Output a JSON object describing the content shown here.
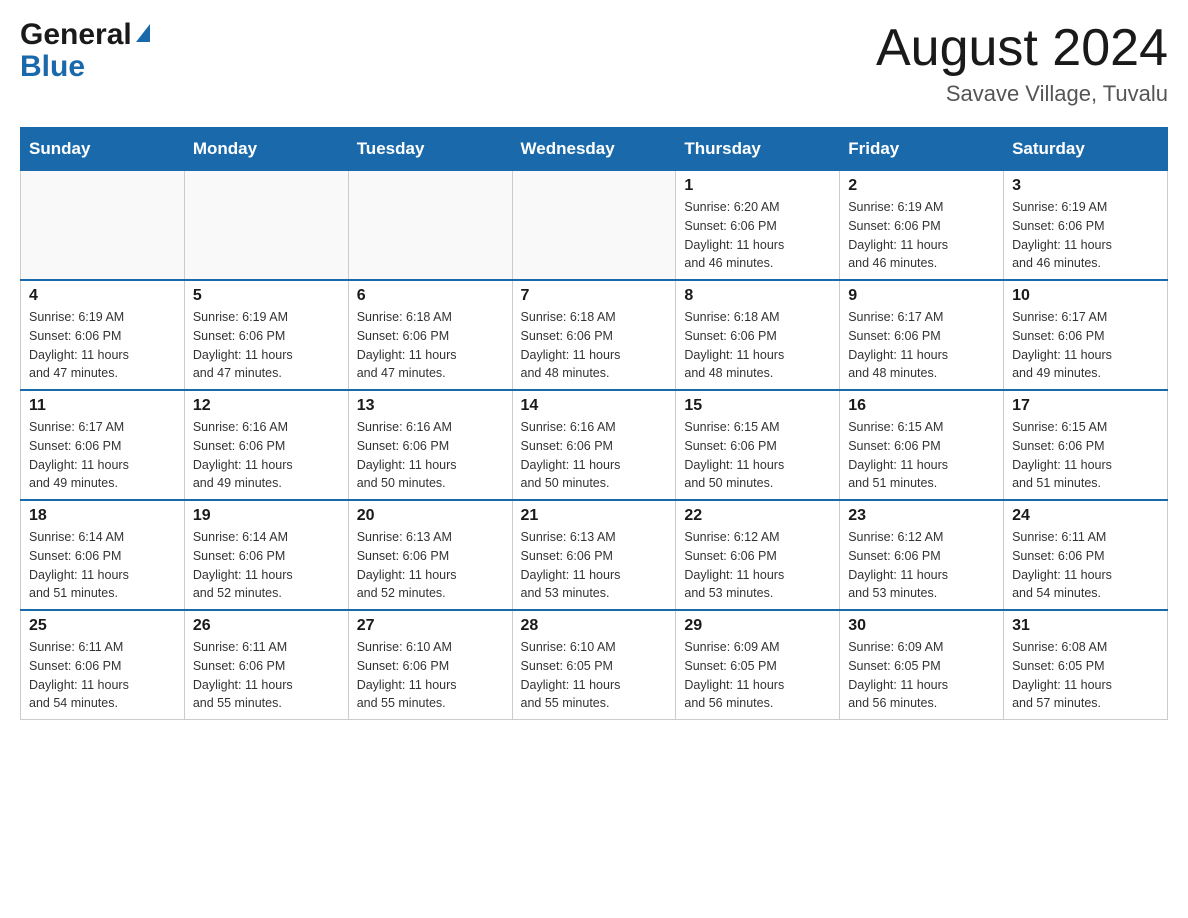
{
  "header": {
    "logo_general": "General",
    "logo_blue": "Blue",
    "month_title": "August 2024",
    "location": "Savave Village, Tuvalu"
  },
  "weekdays": [
    "Sunday",
    "Monday",
    "Tuesday",
    "Wednesday",
    "Thursday",
    "Friday",
    "Saturday"
  ],
  "weeks": [
    [
      {
        "day": "",
        "info": ""
      },
      {
        "day": "",
        "info": ""
      },
      {
        "day": "",
        "info": ""
      },
      {
        "day": "",
        "info": ""
      },
      {
        "day": "1",
        "info": "Sunrise: 6:20 AM\nSunset: 6:06 PM\nDaylight: 11 hours\nand 46 minutes."
      },
      {
        "day": "2",
        "info": "Sunrise: 6:19 AM\nSunset: 6:06 PM\nDaylight: 11 hours\nand 46 minutes."
      },
      {
        "day": "3",
        "info": "Sunrise: 6:19 AM\nSunset: 6:06 PM\nDaylight: 11 hours\nand 46 minutes."
      }
    ],
    [
      {
        "day": "4",
        "info": "Sunrise: 6:19 AM\nSunset: 6:06 PM\nDaylight: 11 hours\nand 47 minutes."
      },
      {
        "day": "5",
        "info": "Sunrise: 6:19 AM\nSunset: 6:06 PM\nDaylight: 11 hours\nand 47 minutes."
      },
      {
        "day": "6",
        "info": "Sunrise: 6:18 AM\nSunset: 6:06 PM\nDaylight: 11 hours\nand 47 minutes."
      },
      {
        "day": "7",
        "info": "Sunrise: 6:18 AM\nSunset: 6:06 PM\nDaylight: 11 hours\nand 48 minutes."
      },
      {
        "day": "8",
        "info": "Sunrise: 6:18 AM\nSunset: 6:06 PM\nDaylight: 11 hours\nand 48 minutes."
      },
      {
        "day": "9",
        "info": "Sunrise: 6:17 AM\nSunset: 6:06 PM\nDaylight: 11 hours\nand 48 minutes."
      },
      {
        "day": "10",
        "info": "Sunrise: 6:17 AM\nSunset: 6:06 PM\nDaylight: 11 hours\nand 49 minutes."
      }
    ],
    [
      {
        "day": "11",
        "info": "Sunrise: 6:17 AM\nSunset: 6:06 PM\nDaylight: 11 hours\nand 49 minutes."
      },
      {
        "day": "12",
        "info": "Sunrise: 6:16 AM\nSunset: 6:06 PM\nDaylight: 11 hours\nand 49 minutes."
      },
      {
        "day": "13",
        "info": "Sunrise: 6:16 AM\nSunset: 6:06 PM\nDaylight: 11 hours\nand 50 minutes."
      },
      {
        "day": "14",
        "info": "Sunrise: 6:16 AM\nSunset: 6:06 PM\nDaylight: 11 hours\nand 50 minutes."
      },
      {
        "day": "15",
        "info": "Sunrise: 6:15 AM\nSunset: 6:06 PM\nDaylight: 11 hours\nand 50 minutes."
      },
      {
        "day": "16",
        "info": "Sunrise: 6:15 AM\nSunset: 6:06 PM\nDaylight: 11 hours\nand 51 minutes."
      },
      {
        "day": "17",
        "info": "Sunrise: 6:15 AM\nSunset: 6:06 PM\nDaylight: 11 hours\nand 51 minutes."
      }
    ],
    [
      {
        "day": "18",
        "info": "Sunrise: 6:14 AM\nSunset: 6:06 PM\nDaylight: 11 hours\nand 51 minutes."
      },
      {
        "day": "19",
        "info": "Sunrise: 6:14 AM\nSunset: 6:06 PM\nDaylight: 11 hours\nand 52 minutes."
      },
      {
        "day": "20",
        "info": "Sunrise: 6:13 AM\nSunset: 6:06 PM\nDaylight: 11 hours\nand 52 minutes."
      },
      {
        "day": "21",
        "info": "Sunrise: 6:13 AM\nSunset: 6:06 PM\nDaylight: 11 hours\nand 53 minutes."
      },
      {
        "day": "22",
        "info": "Sunrise: 6:12 AM\nSunset: 6:06 PM\nDaylight: 11 hours\nand 53 minutes."
      },
      {
        "day": "23",
        "info": "Sunrise: 6:12 AM\nSunset: 6:06 PM\nDaylight: 11 hours\nand 53 minutes."
      },
      {
        "day": "24",
        "info": "Sunrise: 6:11 AM\nSunset: 6:06 PM\nDaylight: 11 hours\nand 54 minutes."
      }
    ],
    [
      {
        "day": "25",
        "info": "Sunrise: 6:11 AM\nSunset: 6:06 PM\nDaylight: 11 hours\nand 54 minutes."
      },
      {
        "day": "26",
        "info": "Sunrise: 6:11 AM\nSunset: 6:06 PM\nDaylight: 11 hours\nand 55 minutes."
      },
      {
        "day": "27",
        "info": "Sunrise: 6:10 AM\nSunset: 6:06 PM\nDaylight: 11 hours\nand 55 minutes."
      },
      {
        "day": "28",
        "info": "Sunrise: 6:10 AM\nSunset: 6:05 PM\nDaylight: 11 hours\nand 55 minutes."
      },
      {
        "day": "29",
        "info": "Sunrise: 6:09 AM\nSunset: 6:05 PM\nDaylight: 11 hours\nand 56 minutes."
      },
      {
        "day": "30",
        "info": "Sunrise: 6:09 AM\nSunset: 6:05 PM\nDaylight: 11 hours\nand 56 minutes."
      },
      {
        "day": "31",
        "info": "Sunrise: 6:08 AM\nSunset: 6:05 PM\nDaylight: 11 hours\nand 57 minutes."
      }
    ]
  ]
}
